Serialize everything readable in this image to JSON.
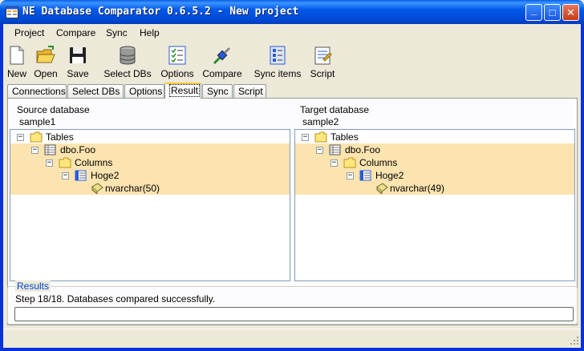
{
  "window": {
    "title": "NE Database Comparator 0.6.5.2 - New project",
    "controls": {
      "minimize": "_",
      "maximize": "□",
      "close": "✕"
    }
  },
  "menu": [
    {
      "label": "Project"
    },
    {
      "label": "Compare"
    },
    {
      "label": "Sync"
    },
    {
      "label": "Help"
    }
  ],
  "toolbar": [
    {
      "label": "New",
      "icon": "new-document-icon"
    },
    {
      "label": "Open",
      "icon": "open-folder-icon"
    },
    {
      "label": "Save",
      "icon": "floppy-disk-icon"
    },
    {
      "label": "Select DBs",
      "icon": "database-icon"
    },
    {
      "label": "Options",
      "icon": "options-checklist-icon"
    },
    {
      "label": "Compare",
      "icon": "compare-plug-icon"
    },
    {
      "label": "Sync items",
      "icon": "sync-list-icon"
    },
    {
      "label": "Script",
      "icon": "script-icon"
    }
  ],
  "tabs": [
    {
      "label": "Connections"
    },
    {
      "label": "Select DBs"
    },
    {
      "label": "Options"
    },
    {
      "label": "Result",
      "active": true
    },
    {
      "label": "Sync"
    },
    {
      "label": "Script"
    }
  ],
  "source": {
    "heading": "Source database",
    "name": "sample1",
    "tree": [
      {
        "text": "Tables",
        "expander": "−"
      },
      {
        "text": "dbo.Foo",
        "expander": "−"
      },
      {
        "text": "Columns",
        "expander": "−"
      },
      {
        "text": "Hoge2",
        "expander": "−"
      },
      {
        "text": "nvarchar(50)",
        "expander": ""
      }
    ]
  },
  "target": {
    "heading": "Target database",
    "name": "sample2",
    "tree": [
      {
        "text": "Tables",
        "expander": "−"
      },
      {
        "text": "dbo.Foo",
        "expander": "−"
      },
      {
        "text": "Columns",
        "expander": "−"
      },
      {
        "text": "Hoge2",
        "expander": "−"
      },
      {
        "text": "nvarchar(49)",
        "expander": ""
      }
    ]
  },
  "results": {
    "legend": "Results",
    "message": "Step 18/18. Databases compared successfully."
  },
  "colors": {
    "titlebar": "#0054E3",
    "highlight_row": "#FCE4B0",
    "results_legend": "#0046D5",
    "active_tab_accent": "#FFC83C"
  }
}
